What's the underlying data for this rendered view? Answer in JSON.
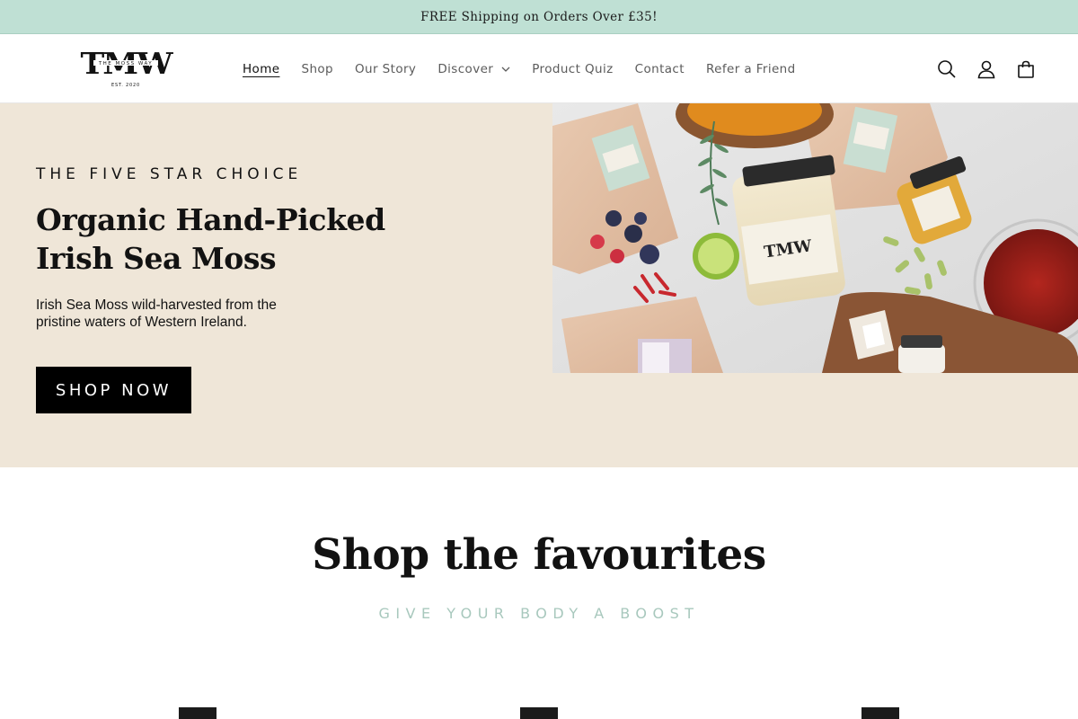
{
  "announcement": {
    "text": "FREE Shipping on Orders Over £35!"
  },
  "header": {
    "logo": {
      "monogram": "TMW",
      "name": "THE MOSS WAY",
      "est": "EST. 2020"
    },
    "nav": [
      {
        "label": "Home",
        "active": true
      },
      {
        "label": "Shop"
      },
      {
        "label": "Our Story"
      },
      {
        "label": "Discover",
        "has_dropdown": true
      },
      {
        "label": "Product Quiz"
      },
      {
        "label": "Contact"
      },
      {
        "label": "Refer a Friend"
      }
    ],
    "icons": [
      "search-icon",
      "account-icon",
      "cart-icon"
    ]
  },
  "hero": {
    "kicker": "THE FIVE STAR CHOICE",
    "title_line1": "Organic Hand-Picked",
    "title_line2": "Irish Sea Moss",
    "text": "Irish Sea Moss wild-harvested from the pristine waters of Western Ireland.",
    "button": "SHOP NOW",
    "jar_label": "TMW",
    "colors": {
      "background": "#efe6d8",
      "button": "#000000"
    }
  },
  "favourites": {
    "title": "Shop the favourites",
    "subtitle": "GIVE YOUR BODY A BOOST"
  },
  "colors": {
    "announcement_bg": "#bfe0d4",
    "accent_text": "#a8c8bd"
  }
}
